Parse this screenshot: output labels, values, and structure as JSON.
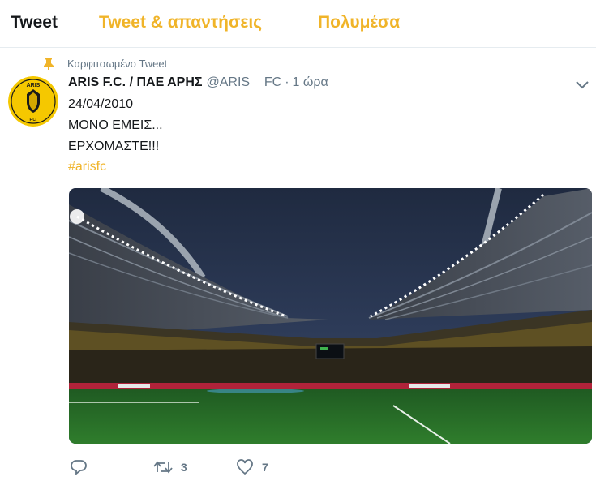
{
  "tabs": [
    {
      "label": "Tweet"
    },
    {
      "label": "Tweet & απαντήσεις"
    },
    {
      "label": "Πολυμέσα"
    }
  ],
  "pinned_label": "Καρφιτσωμένο Tweet",
  "tweet": {
    "author_name": "ARIS F.C. / ΠΑΕ ΑΡΗΣ",
    "handle": "@ARIS__FC",
    "separator": "·",
    "time": "1 ώρα",
    "lines": [
      "24/04/2010",
      "ΜΟΝΟ ΕΜΕΙΣ...",
      "ΕΡΧΟΜΑΣΤΕ!!!"
    ],
    "hashtag": "#arisfc",
    "avatar_text": "ARIS",
    "avatar_sub": "F.C.",
    "retweet_count": "3",
    "like_count": "7"
  },
  "colors": {
    "accent": "#f0b429",
    "muted": "#657786",
    "text": "#14171a"
  },
  "icons": {
    "pin": "pin-icon",
    "caret": "chevron-down-icon",
    "reply": "reply-icon",
    "retweet": "retweet-icon",
    "like": "heart-icon"
  }
}
